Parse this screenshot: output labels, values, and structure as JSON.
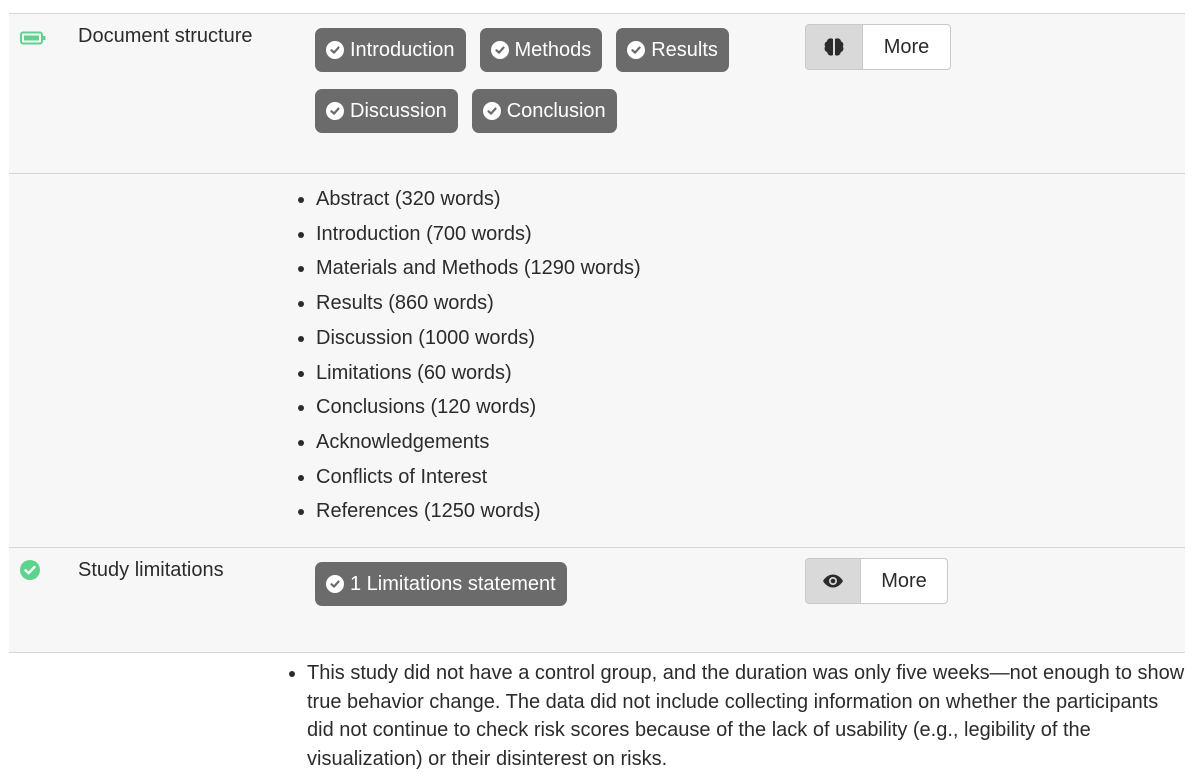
{
  "document_structure": {
    "label": "Document structure",
    "status_icon": "battery-icon",
    "status_color": "#5fd38d",
    "sections": [
      {
        "label": "Introduction"
      },
      {
        "label": "Methods"
      },
      {
        "label": "Results"
      },
      {
        "label": "Discussion"
      },
      {
        "label": "Conclusion"
      }
    ],
    "more_button": {
      "icon": "brain-icon",
      "label": "More"
    },
    "word_counts": [
      "Abstract (320 words)",
      "Introduction (700 words)",
      "Materials and Methods (1290 words)",
      "Results (860 words)",
      "Discussion (1000 words)",
      "Limitations (60 words)",
      "Conclusions (120 words)",
      "Acknowledgements",
      "Conflicts of Interest",
      "References (1250 words)"
    ]
  },
  "study_limitations": {
    "label": "Study limitations",
    "status_icon": "check-circle-icon",
    "status_color": "#5fd38d",
    "tag": "1 Limitations statement",
    "more_button": {
      "icon": "eye-icon",
      "label": "More"
    },
    "statement": "This study did not have a control group, and the duration was only five weeks—not enough to show true behavior change. The data did not include collecting information on whether the participants did not continue to check risk scores because of the lack of usability (e.g., legibility of the visualization) or their disinterest on risks."
  }
}
